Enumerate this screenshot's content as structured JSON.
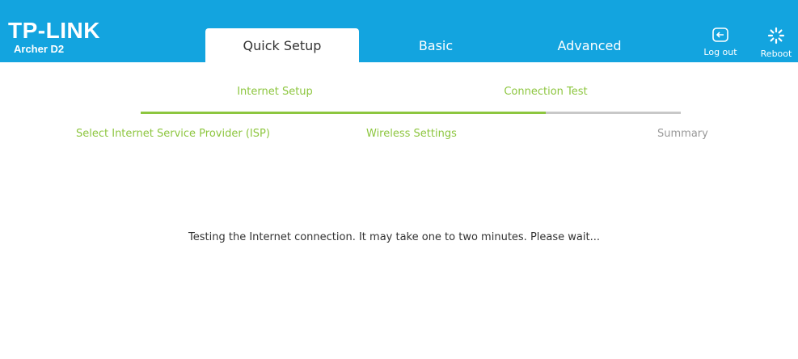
{
  "header": {
    "brand": "TP-LINK",
    "model": "Archer D2",
    "tabs": [
      {
        "label": "Quick Setup"
      },
      {
        "label": "Basic"
      },
      {
        "label": "Advanced"
      }
    ],
    "logout_label": "Log out",
    "reboot_label": "Reboot",
    "logout_icon": "logout-icon",
    "reboot_icon": "reboot-icon"
  },
  "progress": {
    "top_steps": [
      {
        "label": "Internet Setup"
      },
      {
        "label": "Connection Test"
      }
    ],
    "sub_steps": [
      {
        "label": "Select Internet Service Provider (ISP)"
      },
      {
        "label": "Wireless Settings"
      },
      {
        "label": "Summary"
      }
    ],
    "completed_fraction": 0.75
  },
  "main": {
    "message": "Testing the Internet connection. It may take one to two minutes. Please wait..."
  },
  "colors": {
    "header": "#13a4df",
    "accent_green": "#8dc63f",
    "inactive_gray": "#999999",
    "bar_gray": "#c8c8c8"
  }
}
